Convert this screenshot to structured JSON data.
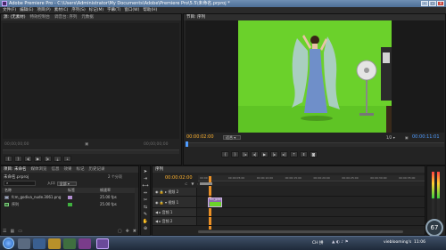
{
  "app": {
    "title": "Adobe Premiere Pro - C:\\Users\\Administrator\\My Documents\\Adobe\\Premiere Pro\\5.5\\未命名.prproj *",
    "window_buttons": {
      "minimize": "–",
      "maximize": "□",
      "close": "✕"
    }
  },
  "menu": [
    "文件(F)",
    "编辑(E)",
    "项目(P)",
    "素材(C)",
    "序列(S)",
    "标记(M)",
    "字幕(T)",
    "窗口(W)",
    "帮助(H)"
  ],
  "source_panel": {
    "tabs": [
      "源: (无素材)",
      "特效控制台",
      "调音台: 序列",
      "元数据"
    ],
    "timecode_left": "00;00;00;00",
    "timecode_right": "00;00;00;00"
  },
  "program_panel": {
    "tab": "节目: 序列",
    "timecode_current": "00:00:02:00",
    "fit_label": "适合",
    "scale_label": "1/2",
    "timecode_duration": "00:00:11:01"
  },
  "project_panel": {
    "tabs": [
      "项目: 未命名",
      "媒体浏览",
      "信息",
      "效果",
      "标记",
      "历史记录"
    ],
    "project_file": "未命名.prproj",
    "item_count": "2 个分项",
    "entry_label": "入口:",
    "entry_value": "全部",
    "columns": [
      "名称",
      "标签",
      "帧速率"
    ],
    "items": [
      {
        "name": "fcm_godiva_nude.3061.png",
        "rate": "25.00 fps",
        "label_color": "#b08ccf"
      },
      {
        "name": "序列",
        "rate": "25.00 fps",
        "label_color": "#3fb13f"
      }
    ]
  },
  "timeline_panel": {
    "tab": "序列",
    "timecode": "00:00:02:00",
    "ruler_marks": [
      "00:00",
      "00:00:05:00",
      "00:00:10:00",
      "00:00:15:00",
      "00:00:20:00",
      "00:00:25:00",
      "00:00:30:00",
      "00:00:35:00"
    ],
    "video_tracks": [
      "视频 2",
      "视频 1"
    ],
    "audio_tracks": [
      "音频 1",
      "音频 2"
    ],
    "clip_label": "fcm_godiva"
  },
  "taskbar": {
    "tray_text": "CH 拼",
    "time": "11:06",
    "user_label": "vieblooming's"
  },
  "overlay_badge": "67",
  "colors": {
    "chroma_green": "#6bd12b",
    "timecode_blue": "#4f9cff",
    "timecode_orange": "#ffb22e",
    "playhead": "#ff9b26"
  }
}
